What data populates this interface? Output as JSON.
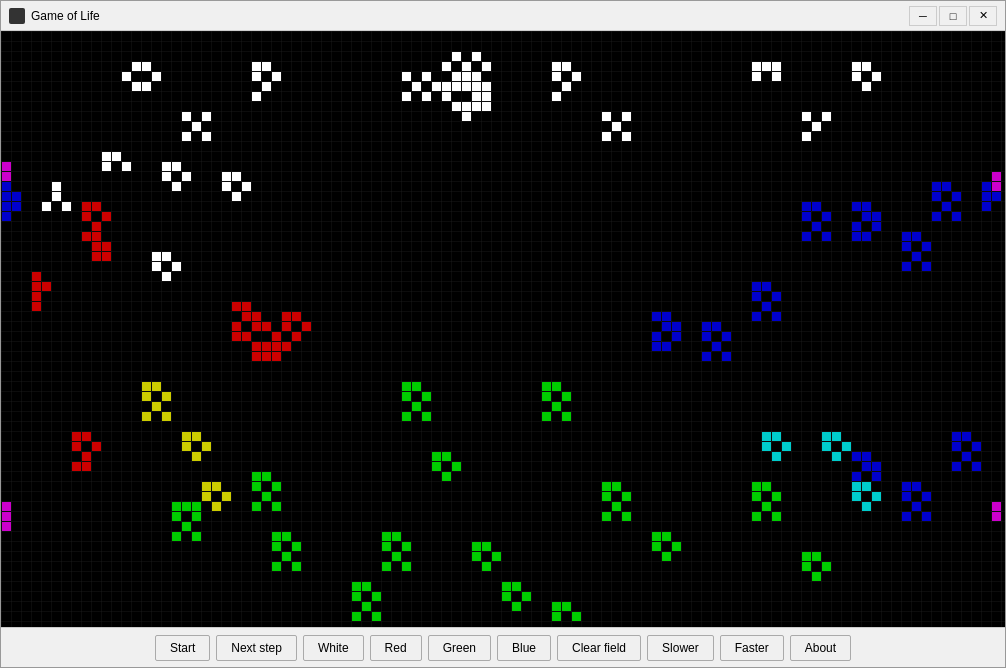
{
  "window": {
    "title": "Game of Life"
  },
  "titlebar": {
    "minimize": "─",
    "maximize": "□",
    "close": "✕"
  },
  "toolbar": {
    "buttons": [
      {
        "id": "start",
        "label": "Start"
      },
      {
        "id": "next-step",
        "label": "Next step"
      },
      {
        "id": "white",
        "label": "White"
      },
      {
        "id": "red",
        "label": "Red"
      },
      {
        "id": "green",
        "label": "Green"
      },
      {
        "id": "blue",
        "label": "Blue"
      },
      {
        "id": "clear-field",
        "label": "Clear field"
      },
      {
        "id": "slower",
        "label": "Slower"
      },
      {
        "id": "faster",
        "label": "Faster"
      },
      {
        "id": "about",
        "label": "About"
      }
    ]
  },
  "colors": {
    "white": "#ffffff",
    "red": "#cc0000",
    "green": "#00aa00",
    "blue": "#0000cc",
    "yellow": "#cccc00",
    "cyan": "#00cccc",
    "magenta": "#cc00cc"
  }
}
